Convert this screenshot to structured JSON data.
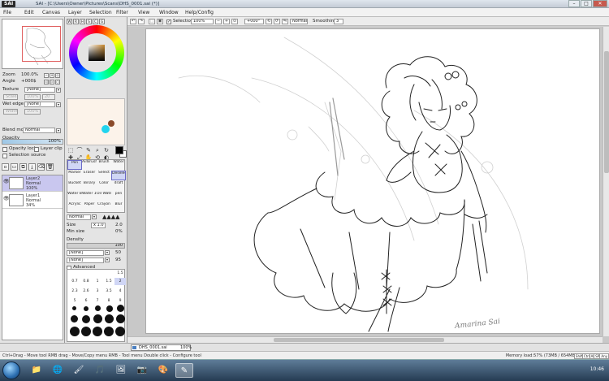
{
  "window": {
    "app_logo": "SAI",
    "title": "SAI - [C:\\Users\\Owner\\Pictures\\Scans\\DHS_0001.sai (*)]",
    "minimize": "–",
    "maximize": "□",
    "close": "✕"
  },
  "menu": [
    "File",
    "Edit",
    "Canvas",
    "Layer",
    "Selection",
    "Filter",
    "View",
    "Window",
    "Help/Config"
  ],
  "toolbar": {
    "selection_label": "Selection",
    "selection_checked": "✓",
    "zoom_value": "100%",
    "angle_value": "+000°",
    "blend_value": "Normal",
    "smoothing_label": "Smoothing",
    "smoothing_value": "3"
  },
  "navigator": {
    "zoom_label": "Zoom",
    "zoom_value": "100.0%",
    "angle_label": "Angle",
    "angle_value": "+000$"
  },
  "texture": {
    "label": "Texture",
    "value": "[None]",
    "scale": "Scale",
    "scale_val": "100%",
    "strength_val": "20"
  },
  "wet_edge": {
    "label": "Wet edge",
    "value": "[None]",
    "width": "Width",
    "width_val": "100%"
  },
  "layer_props": {
    "blend_label": "Blend mode",
    "blend_value": "Normal",
    "opacity_label": "Opacity",
    "opacity_value": "100%",
    "opacity_lock": "Opacity lock",
    "layer_clip": "Layer clip",
    "selection_source": "Selection source"
  },
  "layers": [
    {
      "name": "Layer2",
      "mode": "Normal",
      "opacity": "100%"
    },
    {
      "name": "Layer1",
      "mode": "Normal",
      "opacity": "34%"
    }
  ],
  "color_modes": [
    "W",
    "R",
    "H",
    "S",
    "C",
    "G"
  ],
  "tools_row": [
    "⬚",
    "⌒",
    "✎",
    "⌕",
    "↻",
    "✚",
    "⤢",
    "✋",
    "⟲",
    "◐"
  ],
  "tool_grid": [
    [
      "Pen",
      "AirBrush",
      "Brush",
      "Water"
    ],
    [
      "Marker",
      "Eraser",
      "Select",
      "Deselect"
    ],
    [
      "Bucket",
      "Binary",
      "Color",
      "draft"
    ],
    [
      "Water B",
      "Water 10",
      "Oil Water",
      "pen"
    ],
    [
      "Acrylic",
      "Paper",
      "Crayon",
      "Blur"
    ]
  ],
  "brush": {
    "mode": "Normal",
    "size_label": "Size",
    "size_mult": "x 1.0",
    "size_value": "2.0",
    "min_size_label": "Min size",
    "min_size_value": "0%",
    "density_label": "Density",
    "density_value": "100",
    "shape_value": "[None]",
    "texture_value": "[None]",
    "shape_strength": "50",
    "texture_strength": "95",
    "advanced_label": "Advanced"
  },
  "brush_sizes": [
    [
      "",
      "",
      "",
      "",
      "1.5"
    ],
    [
      "0.7",
      "0.8",
      "1",
      "1.5",
      "2"
    ],
    [
      "2.3",
      "2.6",
      "3",
      "3.5",
      "4"
    ],
    [
      "5",
      "6",
      "7",
      "8",
      "9"
    ]
  ],
  "document_tab": {
    "name": "DHS_0001.sai",
    "zoom": "100%"
  },
  "canvas": {
    "signature": "Amarina Sai"
  },
  "status": {
    "hint": "Ctrl+Drag - Move tool    RMB drag - Move/Copy menu    RMB - Tool menu    Double click - Configure tool",
    "memory": "Memory load:57% (73MB / 654MB)",
    "keys": [
      "Shift",
      "Ctrl",
      "Alt",
      "SPC",
      "Any"
    ]
  },
  "taskbar": {
    "apps": [
      "📁",
      "🌐",
      "🖌",
      "🎵",
      "🖼",
      "📷",
      "🎨",
      "✎"
    ],
    "clock": "10:46"
  },
  "colors": {
    "accent_selected_layer": "#c9c7ef",
    "scratch_black": "#000000",
    "scratch_brown": "#8a4a2a",
    "scratch_cyan": "#22d4ee"
  }
}
